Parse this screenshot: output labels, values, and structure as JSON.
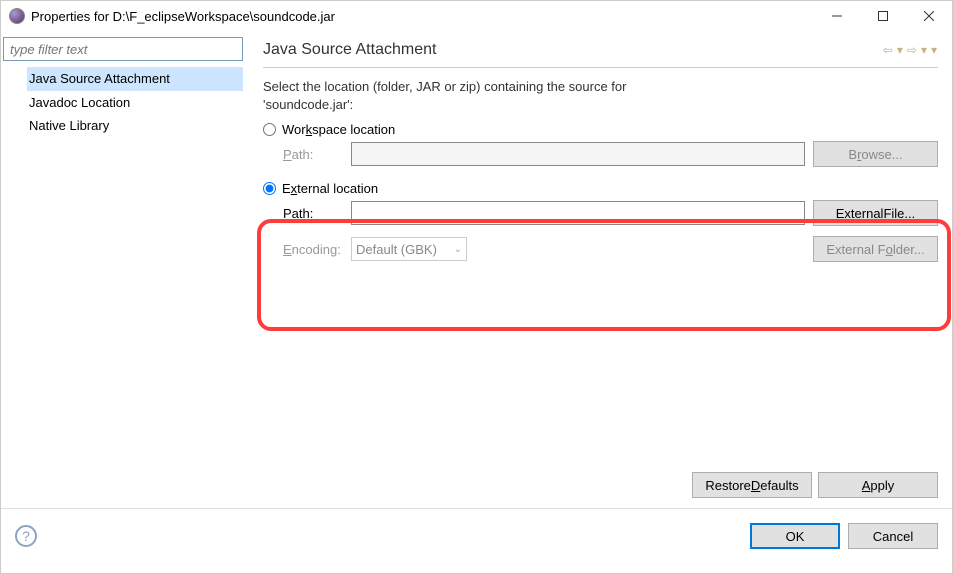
{
  "window": {
    "title": "Properties for D:\\F_eclipseWorkspace\\soundcode.jar",
    "filter_placeholder": "type filter text"
  },
  "tree": {
    "items": [
      {
        "label": "Java Source Attachment",
        "selected": true
      },
      {
        "label": "Javadoc Location",
        "selected": false
      },
      {
        "label": "Native Library",
        "selected": false
      }
    ]
  },
  "page": {
    "title": "Java Source Attachment",
    "description1": "Select the location (folder, JAR or zip) containing the source for",
    "description2": "'soundcode.jar':",
    "workspace": {
      "radio_text": "Workspace location",
      "radio_underline_index": 3,
      "path_label": "Path:",
      "path_value": "",
      "browse_btn": "Browse..."
    },
    "external": {
      "radio_text": "External location",
      "radio_underline_index": 1,
      "path_label": "Path:",
      "path_value": "",
      "encoding_label": "Encoding:",
      "encoding_value": "Default (GBK)",
      "file_btn": "External File...",
      "folder_btn": "External Folder..."
    }
  },
  "buttons": {
    "restore": "Restore Defaults",
    "apply": "Apply",
    "ok": "OK",
    "cancel": "Cancel"
  }
}
